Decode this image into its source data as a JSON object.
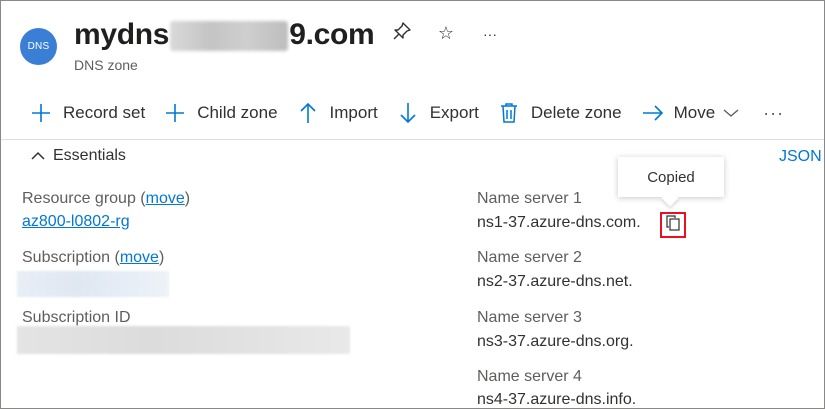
{
  "header": {
    "avatar_text": "DNS",
    "title_prefix": "mydns",
    "title_suffix": "9.com",
    "subtitle": "DNS zone",
    "actions": [
      {
        "name": "pin",
        "glyph": "⚲"
      },
      {
        "name": "favorite",
        "glyph": "☆"
      },
      {
        "name": "more",
        "glyph": "···"
      }
    ]
  },
  "toolbar": {
    "record_set": "Record set",
    "child_zone": "Child zone",
    "import": "Import",
    "export": "Export",
    "delete_zone": "Delete zone",
    "move": "Move",
    "more": "···"
  },
  "essentials": {
    "toggle_label": "Essentials",
    "json_view": "JSON",
    "resource_group_label": "Resource group",
    "move_link": "move",
    "resource_group_value": "az800-l0802-rg",
    "subscription_label": "Subscription",
    "subscription_id_label": "Subscription ID",
    "name_servers": [
      {
        "label": "Name server 1",
        "value": "ns1-37.azure-dns.com."
      },
      {
        "label": "Name server 2",
        "value": "ns2-37.azure-dns.net."
      },
      {
        "label": "Name server 3",
        "value": "ns3-37.azure-dns.org."
      },
      {
        "label": "Name server 4",
        "value": "ns4-37.azure-dns.info."
      }
    ]
  },
  "tooltip": {
    "text": "Copied"
  },
  "colors": {
    "accent": "#0078d4",
    "highlight_box": "#e81123",
    "avatar_bg": "#3a7fd5"
  }
}
